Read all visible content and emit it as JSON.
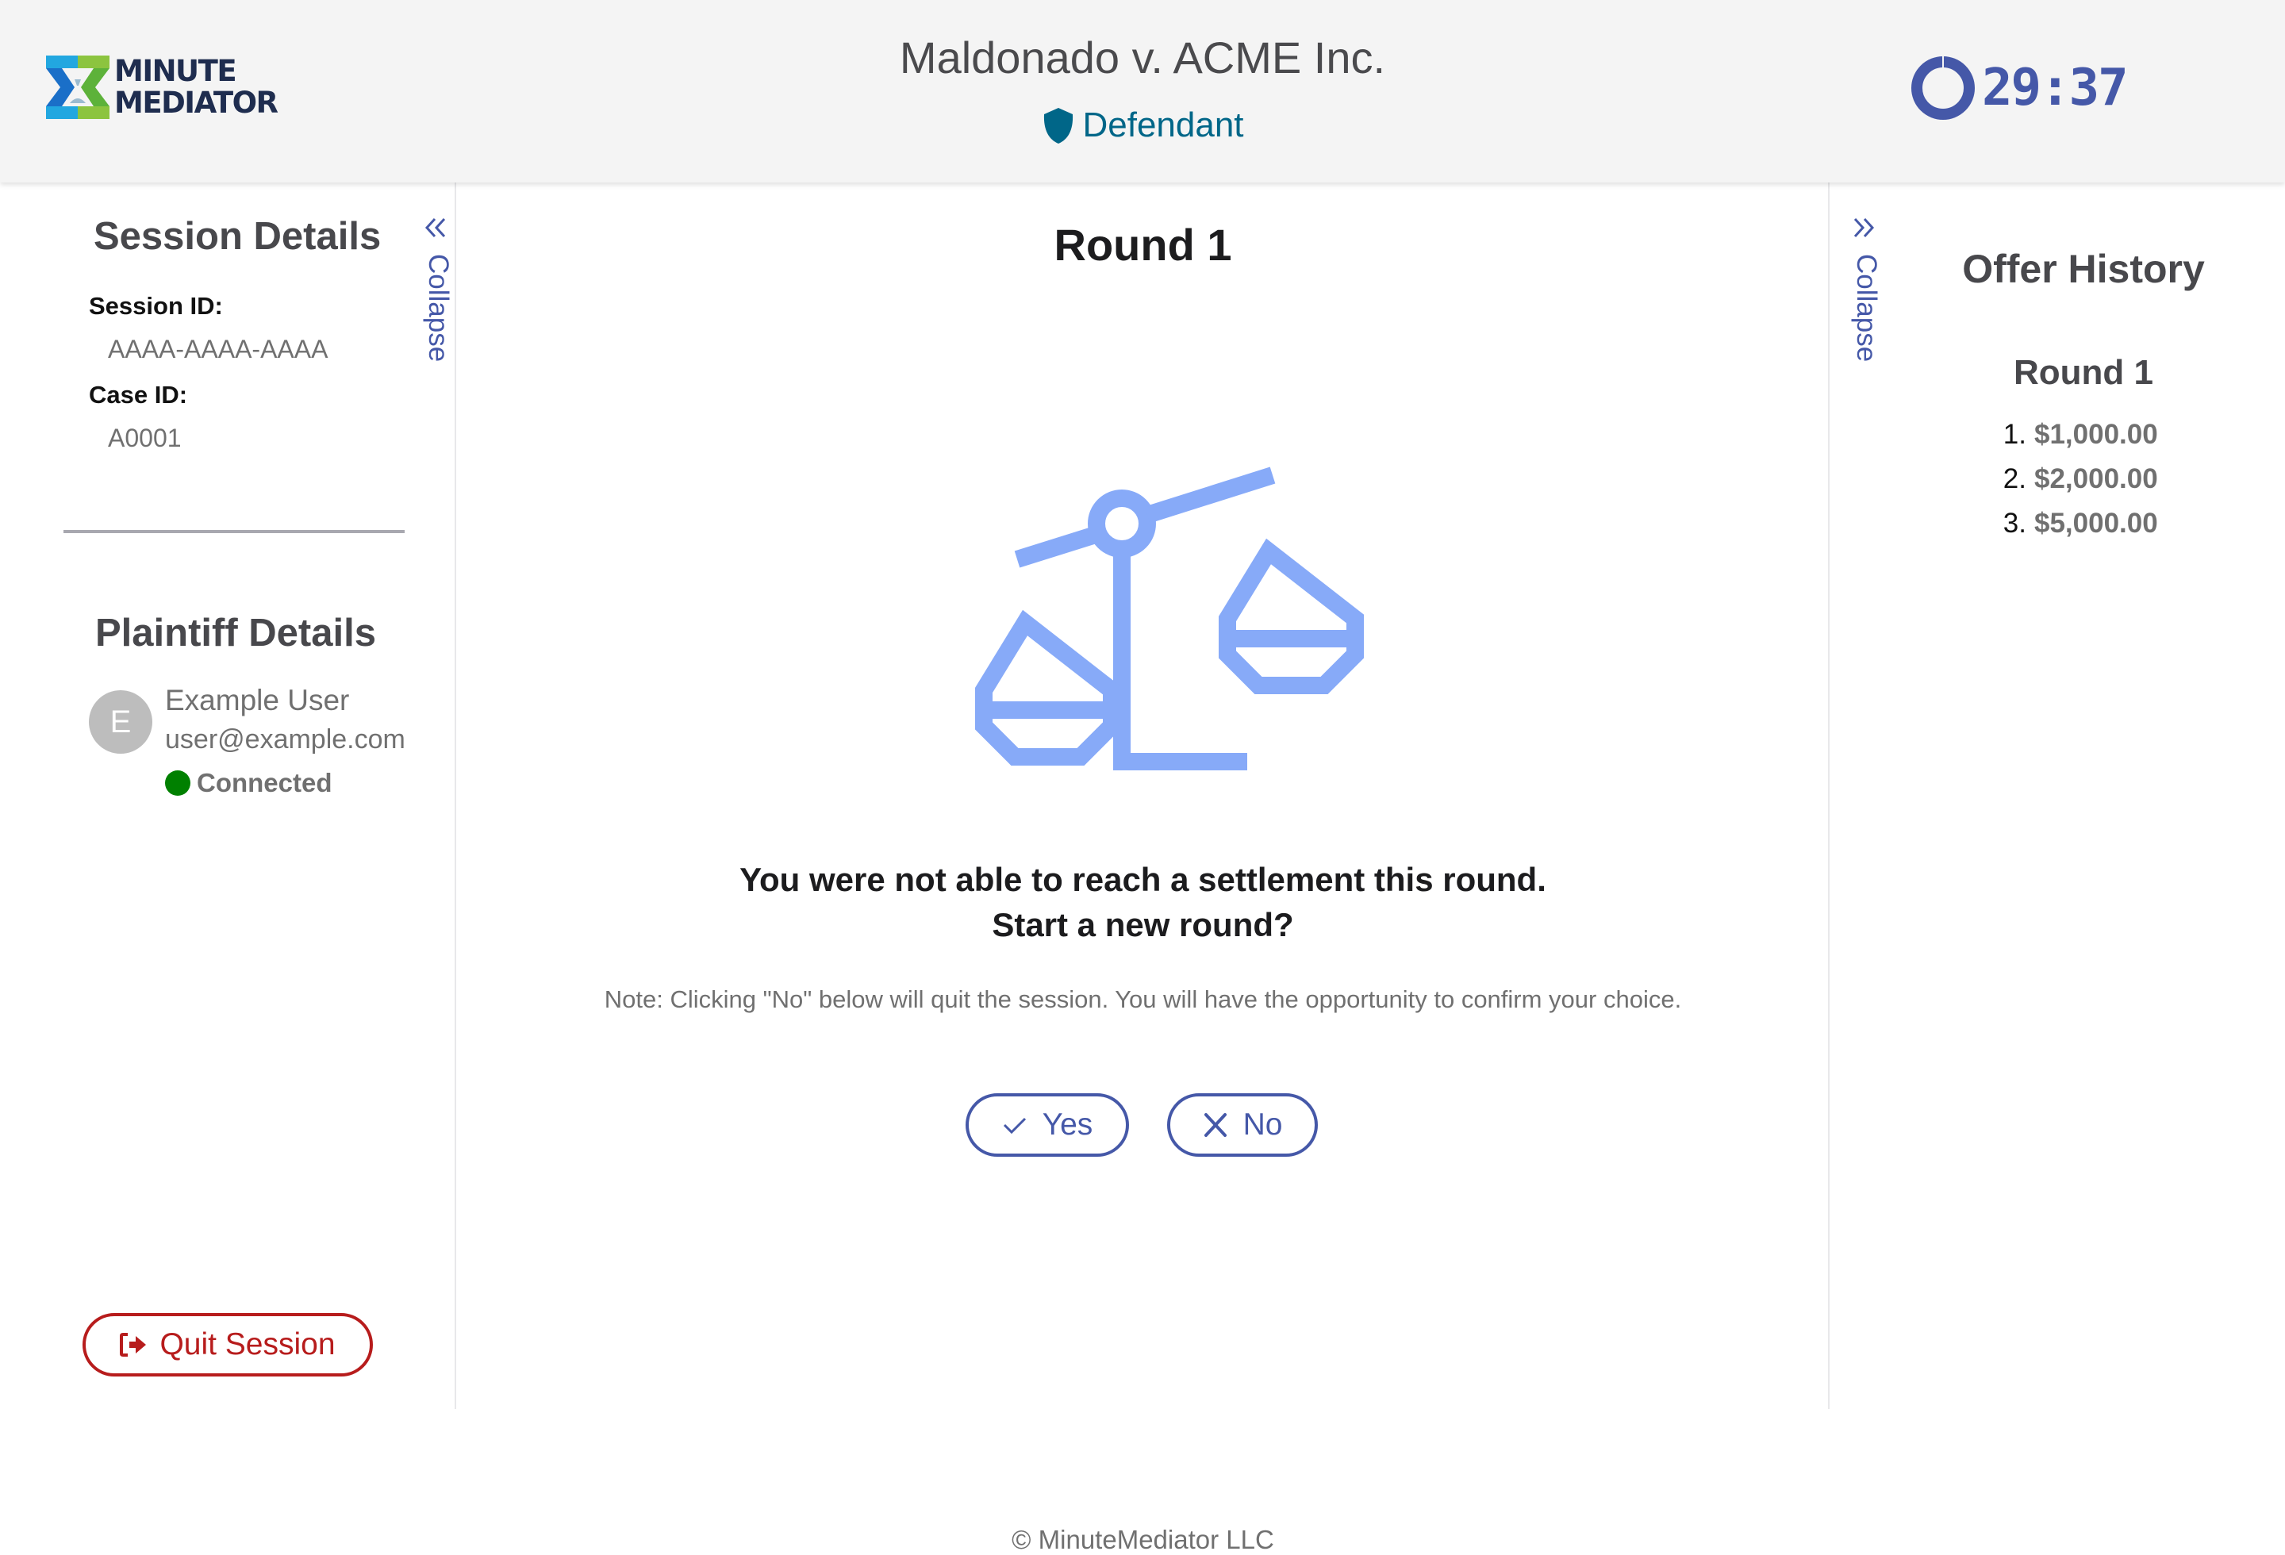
{
  "header": {
    "logo": {
      "line1": "MINUTE",
      "line2": "MEDIATOR"
    },
    "case_title": "Maldonado v. ACME Inc.",
    "role": {
      "label": "Defendant",
      "icon": "shield-icon",
      "color": "#006688"
    },
    "timer": {
      "value": "29:37",
      "remaining_fraction": 0.99,
      "color": "#4558a8"
    }
  },
  "left_panel": {
    "collapse_label": "Collapse",
    "session_details": {
      "title": "Session Details",
      "session_id_label": "Session ID:",
      "session_id": "AAAA-AAAA-AAAA",
      "case_id_label": "Case ID:",
      "case_id": "A0001"
    },
    "plaintiff_details": {
      "title": "Plaintiff Details",
      "avatar_initial": "E",
      "name": "Example User",
      "email": "user@example.com",
      "status": "Connected",
      "status_color": "#008000"
    },
    "quit_label": "Quit Session"
  },
  "main": {
    "round_title": "Round 1",
    "message_line1": "You were not able to reach a settlement this round.",
    "message_line2": "Start a new round?",
    "note": "Note: Clicking \"No\" below will quit the session. You will have the opportunity to confirm your choice.",
    "yes_label": "Yes",
    "no_label": "No",
    "footer": "© MinuteMediator LLC",
    "illustration": "scales-of-justice-icon"
  },
  "right_panel": {
    "collapse_label": "Collapse",
    "title": "Offer History",
    "rounds": [
      {
        "label": "Round 1",
        "offers": [
          {
            "num": "1.",
            "amount": "$1,000.00"
          },
          {
            "num": "2.",
            "amount": "$2,000.00"
          },
          {
            "num": "3.",
            "amount": "$5,000.00"
          }
        ]
      }
    ]
  }
}
